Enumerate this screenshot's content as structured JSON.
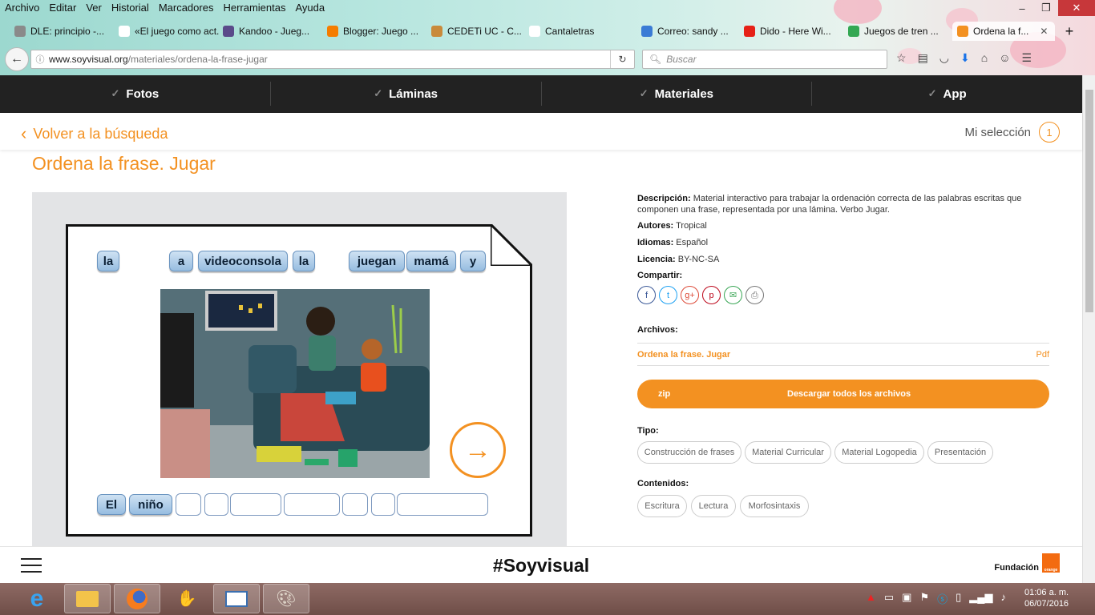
{
  "browser": {
    "menu": [
      "Archivo",
      "Editar",
      "Ver",
      "Historial",
      "Marcadores",
      "Herramientas",
      "Ayuda"
    ],
    "tabs": [
      {
        "label": "DLE: principio -...",
        "color": "#8a8a8a"
      },
      {
        "label": "«El juego como act...",
        "color": "#ffffff"
      },
      {
        "label": "Kandoo - Jueg...",
        "color": "#5a4a8a"
      },
      {
        "label": "Blogger: Juego ...",
        "color": "#f57d00"
      },
      {
        "label": "CEDETi UC - C...",
        "color": "#c98a3a"
      },
      {
        "label": "Cantaletras",
        "color": "#ffffff"
      },
      {
        "label": "Correo: sandy ...",
        "color": "#3a7bd5"
      },
      {
        "label": "Dido - Here Wi...",
        "color": "#e62117"
      },
      {
        "label": "Juegos de tren ...",
        "color": "#34a853"
      },
      {
        "label": "Ordena la f...",
        "color": "#f39121"
      }
    ],
    "url_domain": "www.soyvisual.org",
    "url_path": "/materiales/ordena-la-frase-jugar",
    "search_placeholder": "Buscar",
    "win_min": "–",
    "win_max": "❐",
    "win_close": "✕",
    "tab_close": "✕",
    "tab_new": "+"
  },
  "site": {
    "nav": [
      "Fotos",
      "Láminas",
      "Materiales",
      "App"
    ],
    "back_label": "Volver a la búsqueda",
    "selection_label": "Mi selección",
    "selection_count": "1",
    "page_title": "Ordena la frase. Jugar"
  },
  "activity": {
    "top_words": [
      "la",
      "a",
      "videoconsola",
      "la",
      "juegan",
      "mamá",
      "y"
    ],
    "bottom_words": [
      "El",
      "niño"
    ],
    "next_icon": "arrow-right-icon"
  },
  "info": {
    "desc_label": "Descripción:",
    "desc_text": "Material interactivo para trabajar la ordenación correcta de las palabras escritas que componen una frase, representada por una lámina. Verbo Jugar.",
    "authors_label": "Autores:",
    "authors": "Tropical",
    "lang_label": "Idiomas:",
    "lang": "Español",
    "license_label": "Licencia:",
    "license": "BY-NC-SA",
    "share_label": "Compartir:",
    "share_icons": [
      {
        "name": "facebook-icon",
        "glyph": "f",
        "color": "#3b5998"
      },
      {
        "name": "twitter-icon",
        "glyph": "t",
        "color": "#1da1f2"
      },
      {
        "name": "googleplus-icon",
        "glyph": "g+",
        "color": "#dd4b39"
      },
      {
        "name": "pinterest-icon",
        "glyph": "p",
        "color": "#bd081c"
      },
      {
        "name": "email-icon",
        "glyph": "✉",
        "color": "#3aa655"
      },
      {
        "name": "print-icon",
        "glyph": "⎙",
        "color": "#777777"
      }
    ],
    "files_label": "Archivos:",
    "file_name": "Ordena la frase. Jugar",
    "file_type": "Pdf",
    "zip_label": "zip",
    "download_label": "Descargar todos los archivos",
    "type_label": "Tipo:",
    "types": [
      "Construcción de frases",
      "Material Curricular",
      "Material Logopedia",
      "Presentación"
    ],
    "contents_label": "Contenidos:",
    "contents": [
      "Escritura",
      "Lectura",
      "Morfosintaxis"
    ]
  },
  "footer": {
    "hashtag": "#Soyvisual",
    "foundation": "Fundación",
    "logo_text": "orange"
  },
  "taskbar": {
    "time": "01:06 a. m.",
    "date": "06/07/2016"
  },
  "colors": {
    "accent": "#f39121",
    "nav_bg": "#222222"
  }
}
